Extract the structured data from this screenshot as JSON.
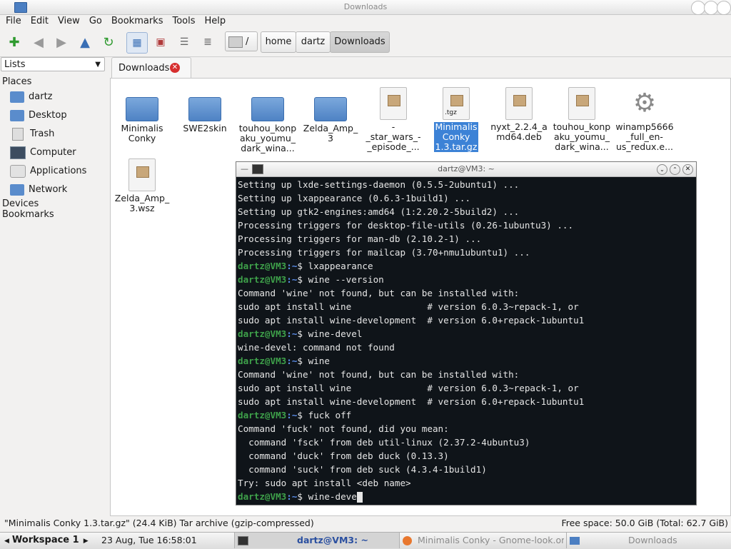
{
  "window": {
    "title": "Downloads"
  },
  "menu": [
    "File",
    "Edit",
    "View",
    "Go",
    "Bookmarks",
    "Tools",
    "Help"
  ],
  "toolbar": {
    "breadcrumb_root": "/",
    "breadcrumbs": [
      "home",
      "dartz",
      "Downloads"
    ]
  },
  "sidebar": {
    "combo": "Lists",
    "places_header": "Places",
    "items": [
      "dartz",
      "Desktop",
      "Trash",
      "Computer",
      "Applications",
      "Network"
    ],
    "devices_header": "Devices",
    "bookmarks_header": "Bookmarks"
  },
  "tab": {
    "label": "Downloads"
  },
  "files": [
    {
      "name": "Minimalis\nConky",
      "type": "folder"
    },
    {
      "name": "SWE2skin",
      "type": "folder"
    },
    {
      "name": "touhou_konp\naku_youmu_\ndark_wina...",
      "type": "folder"
    },
    {
      "name": "Zelda_Amp_\n3",
      "type": "folder"
    },
    {
      "name": "-\n_star_wars_-\n_episode_...",
      "type": "archive"
    },
    {
      "name": "Minimalis\nConky\n1.3.tar.gz",
      "type": "archive",
      "badge": ".tgz",
      "selected": true
    },
    {
      "name": "nyxt_2.2.4_a\nmd64.deb",
      "type": "package"
    },
    {
      "name": "touhou_konp\naku_youmu_\ndark_wina...",
      "type": "archive"
    },
    {
      "name": "winamp5666\n_full_en-\nus_redux.e...",
      "type": "executable"
    },
    {
      "name": "Zelda_Amp_\n3.wsz",
      "type": "archive"
    }
  ],
  "terminal": {
    "title": "dartz@VM3: ~",
    "prompt_user": "dartz@VM3",
    "prompt_dir": ":~",
    "lines": [
      {
        "t": "out",
        "text": "Setting up lxde-settings-daemon (0.5.5-2ubuntu1) ..."
      },
      {
        "t": "out",
        "text": "Setting up lxappearance (0.6.3-1build1) ..."
      },
      {
        "t": "out",
        "text": "Setting up gtk2-engines:amd64 (1:2.20.2-5build2) ..."
      },
      {
        "t": "out",
        "text": "Processing triggers for desktop-file-utils (0.26-1ubuntu3) ..."
      },
      {
        "t": "out",
        "text": "Processing triggers for man-db (2.10.2-1) ..."
      },
      {
        "t": "out",
        "text": "Processing triggers for mailcap (3.70+nmu1ubuntu1) ..."
      },
      {
        "t": "cmd",
        "text": "$ lxappearance"
      },
      {
        "t": "cmd",
        "text": "$ wine --version"
      },
      {
        "t": "out",
        "text": "Command 'wine' not found, but can be installed with:"
      },
      {
        "t": "out",
        "text": "sudo apt install wine              # version 6.0.3~repack-1, or"
      },
      {
        "t": "out",
        "text": "sudo apt install wine-development  # version 6.0+repack-1ubuntu1"
      },
      {
        "t": "cmd",
        "text": "$ wine-devel"
      },
      {
        "t": "out",
        "text": "wine-devel: command not found"
      },
      {
        "t": "cmd",
        "text": "$ wine"
      },
      {
        "t": "out",
        "text": "Command 'wine' not found, but can be installed with:"
      },
      {
        "t": "out",
        "text": "sudo apt install wine              # version 6.0.3~repack-1, or"
      },
      {
        "t": "out",
        "text": "sudo apt install wine-development  # version 6.0+repack-1ubuntu1"
      },
      {
        "t": "cmd",
        "text": "$ fuck off"
      },
      {
        "t": "out",
        "text": "Command 'fuck' not found, did you mean:"
      },
      {
        "t": "out",
        "text": "  command 'fsck' from deb util-linux (2.37.2-4ubuntu3)"
      },
      {
        "t": "out",
        "text": "  command 'duck' from deb duck (0.13.3)"
      },
      {
        "t": "out",
        "text": "  command 'suck' from deb suck (4.3.4-1build1)"
      },
      {
        "t": "out",
        "text": "Try: sudo apt install <deb name>"
      },
      {
        "t": "cmd",
        "text": "$ wine-deve",
        "cursor": true
      }
    ]
  },
  "statusbar": {
    "left": "\"Minimalis Conky 1.3.tar.gz\" (24.4 KiB) Tar archive (gzip-compressed)",
    "right": "Free space: 50.0 GiB (Total: 62.7 GiB)"
  },
  "panel": {
    "workspace": "Workspace 1",
    "clock": "23 Aug, Tue 16:58:01",
    "tasks": [
      "dartz@VM3: ~",
      "Minimalis Conky - Gnome-look.org — M",
      "Downloads"
    ]
  },
  "colors": {
    "selection": "#3c82d6",
    "terminal_bg": "#0f1419",
    "prompt_user": "#3ea14a",
    "prompt_dir": "#5b8de8"
  }
}
